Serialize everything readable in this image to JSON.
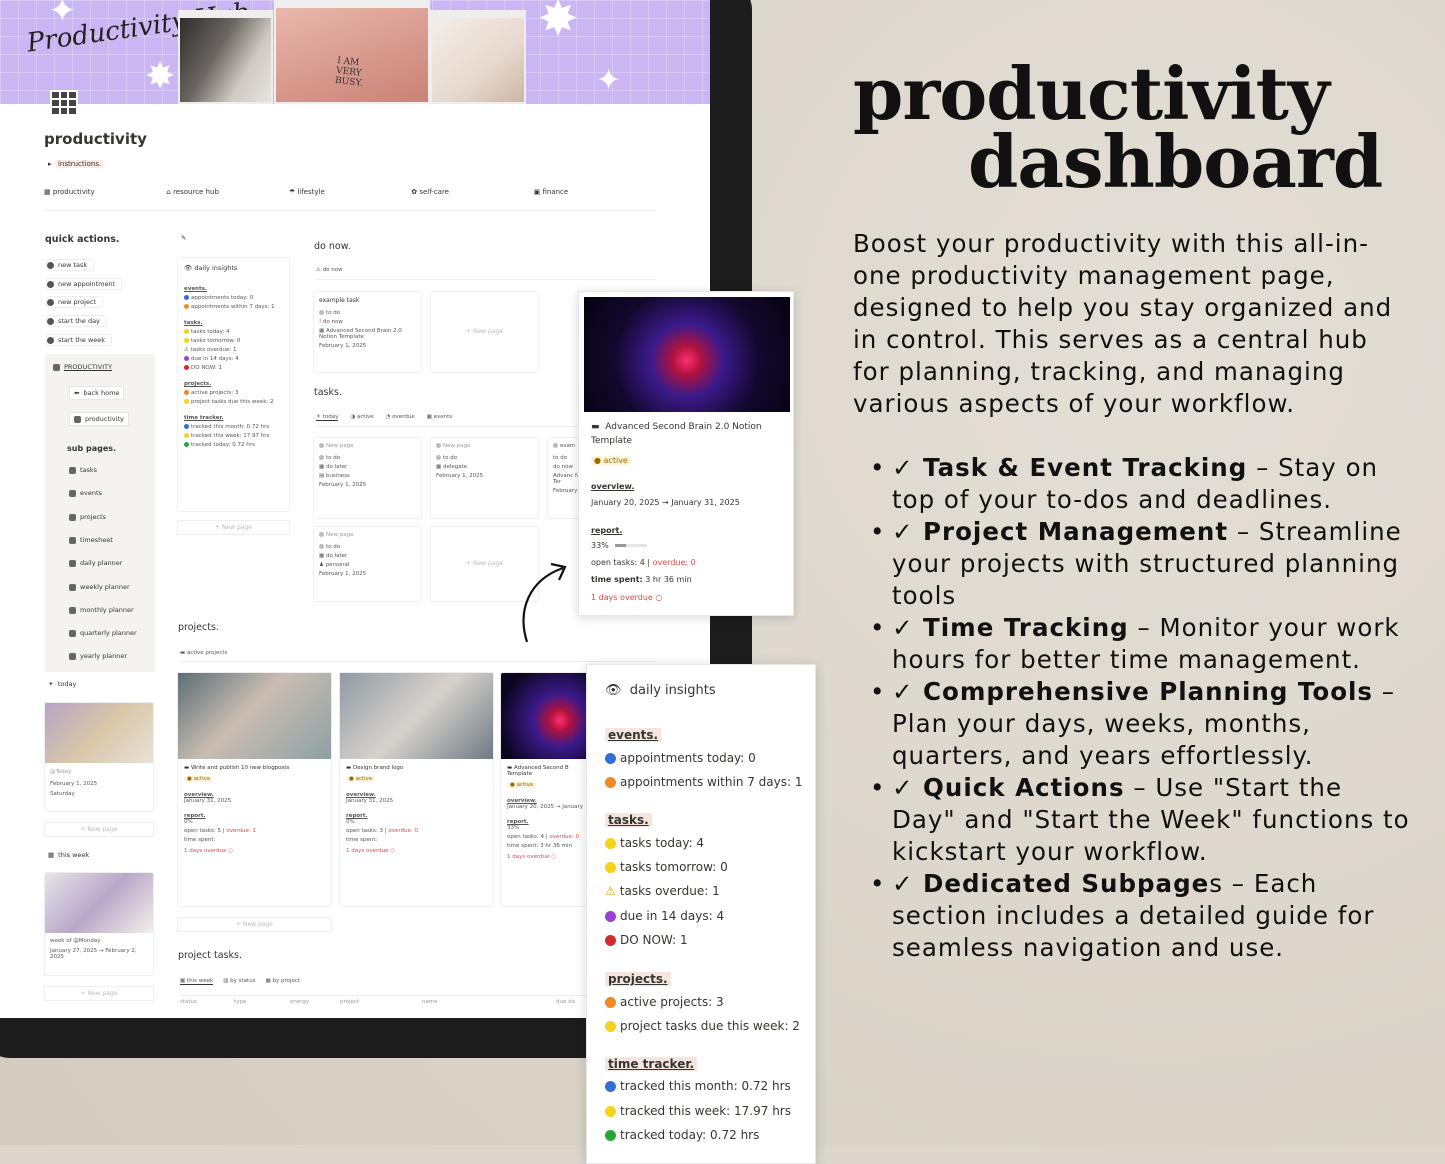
{
  "app": {
    "logo": "Productivity Hub",
    "page_title": "productivity",
    "instructions": "instructions.",
    "photo_sign": "I AM VERY BUSY."
  },
  "nav": [
    "productivity",
    "resource hub",
    "lifestyle",
    "self-care",
    "finance"
  ],
  "quick_actions": {
    "title": "quick actions.",
    "items": [
      "new task",
      "new appointment",
      "new project",
      "start the day",
      "start the week"
    ]
  },
  "sidebar": {
    "header": "PRODUCTIVITY",
    "back": "back home",
    "productivity": "productivity",
    "sub_pages_title": "sub pages.",
    "items": [
      "tasks",
      "events",
      "projects",
      "timesheet",
      "daily planner",
      "weekly planner",
      "monthly planner",
      "quarterly planner",
      "yearly planner"
    ]
  },
  "today": {
    "label": "today",
    "card_title": "@Today",
    "date": "February 1, 2025",
    "day": "Saturday",
    "new_page": "+ New page",
    "this_week": "this week",
    "week_title": "week of @Monday",
    "week_range": "January 27, 2025 → February 2, 2025"
  },
  "insights_small": {
    "title": "daily insights",
    "events_h": "events.",
    "events": [
      "appointments today: 0",
      "appointments within 7 days: 1"
    ],
    "tasks_h": "tasks.",
    "tasks": [
      "tasks today: 4",
      "tasks tomorrow: 0",
      "tasks overdue: 1",
      "due in 14 days: 4",
      "DO NOW: 1"
    ],
    "projects_h": "projects.",
    "projects": [
      "active projects: 3",
      "project tasks due this week: 2"
    ],
    "time_h": "time tracker.",
    "time": [
      "tracked this month: 0.72 hrs",
      "tracked this week: 17.97 hrs",
      "tracked today: 0.72 hrs"
    ],
    "new_page": "+ New page"
  },
  "do_now": {
    "title": "do now.",
    "view": "do now",
    "card": {
      "title": "example task",
      "status": "to do",
      "priority": "do now",
      "project": "Advanced Second Brain 2.0 Notion Template",
      "date": "February 1, 2025"
    },
    "new_page": "+ New page"
  },
  "tasks": {
    "title": "tasks.",
    "tabs": [
      "today",
      "active",
      "overdue",
      "events"
    ],
    "cards": [
      {
        "title": "New page",
        "status": "to do",
        "priority": "do later",
        "area": "business",
        "date": "February 1, 2025"
      },
      {
        "title": "New page",
        "status": "to do",
        "priority": "delegate",
        "date": "February 1, 2025"
      },
      {
        "title": "exam",
        "status": "to do",
        "priority": "do now",
        "project": "Advanc Notion Ter",
        "date": "February"
      },
      {
        "title": "New page",
        "status": "to do",
        "priority": "do later",
        "area": "personal",
        "date": "February 1, 2025"
      }
    ],
    "new_page": "+ New page"
  },
  "projects": {
    "title": "projects.",
    "view": "active projects",
    "cards": [
      {
        "title": "Write and publish 10 new blogposts",
        "status": "active",
        "overview": "January 31, 2025",
        "report": "0%",
        "open": "open tasks: 5",
        "overdue": "overdue: 1",
        "time": "time spent:",
        "late": "1 days overdue"
      },
      {
        "title": "Design brand logo",
        "status": "active",
        "overview": "January 31, 2025",
        "report": "0%",
        "open": "open tasks: 3",
        "overdue": "overdue: 0",
        "time": "time spent:",
        "late": "1 days overdue"
      },
      {
        "title": "Advanced Second B Template",
        "status": "active",
        "overview": "January 20, 2025 → January",
        "report": "33%",
        "open": "open tasks: 4",
        "overdue": "overdue: 0",
        "time": "time spent: 3 hr 36 min",
        "late": "1 days overdue"
      }
    ],
    "labels": {
      "overview": "overview.",
      "report": "report."
    },
    "new_page": "+ New page"
  },
  "project_tasks": {
    "title": "project tasks.",
    "tabs": [
      "this week",
      "by status",
      "by project"
    ],
    "columns": [
      "status",
      "type",
      "energy",
      "project",
      "name",
      "due da"
    ]
  },
  "popup_project": {
    "title": "Advanced Second Brain 2.0 Notion Template",
    "status": "active",
    "overview_h": "overview.",
    "overview": "January 20, 2025 → January 31, 2025",
    "report_h": "report.",
    "report": "33%",
    "progress": 0.33,
    "open_tasks": "open tasks: 4",
    "overdue": "overdue: 0",
    "time_spent_label": "time spent:",
    "time_spent": "3 hr 36 min",
    "late": "1 days overdue"
  },
  "popup_insights": {
    "title": "daily insights",
    "events_h": "events.",
    "events": [
      "appointments today: 0",
      "appointments within 7 days: 1"
    ],
    "tasks_h": "tasks.",
    "tasks": [
      "tasks today: 4",
      "tasks tomorrow: 0",
      "tasks overdue: 1",
      "due in 14 days: 4",
      "DO NOW: 1"
    ],
    "projects_h": "projects.",
    "projects": [
      "active projects: 3",
      "project tasks due this week: 2"
    ],
    "time_h": "time tracker.",
    "time": [
      "tracked this month: 0.72 hrs",
      "tracked this week: 17.97 hrs",
      "tracked today: 0.72 hrs"
    ]
  },
  "marketing": {
    "headline_1": "productivity",
    "headline_2": "dashboard",
    "description": "Boost your productivity with this all-in-one productivity management page, designed to help you stay organized and in control. This serves as a central hub for planning, tracking, and managing various aspects of your workflow.",
    "bullets": [
      {
        "title": "✓ Task & Event Tracking",
        "text": " – Stay on top of your to-dos and deadlines."
      },
      {
        "title": "✓ Project Management",
        "text": " – Streamline your projects with structured planning tools"
      },
      {
        "title": "✓ Time Tracking",
        "text": " – Monitor your work hours for better time management."
      },
      {
        "title": "✓ Comprehensive Planning Tools",
        "text": " – Plan your days, weeks, months, quarters, and years effortlessly."
      },
      {
        "title": "✓ Quick Actions",
        "text": " – Use \"Start the Day\" and \"Start the Week\" functions to kickstart your workflow."
      },
      {
        "title": "✓ Dedicated Subpage",
        "text": "s – Each section includes a detailed guide for seamless navigation and use."
      }
    ]
  },
  "colors": {
    "blue": "#2f6fd6",
    "orange": "#f08a24",
    "yellow": "#f5d21c",
    "purple": "#9b3fd6",
    "red": "#d52a2a",
    "green": "#2aa53a",
    "overdue": "#d44c47"
  }
}
